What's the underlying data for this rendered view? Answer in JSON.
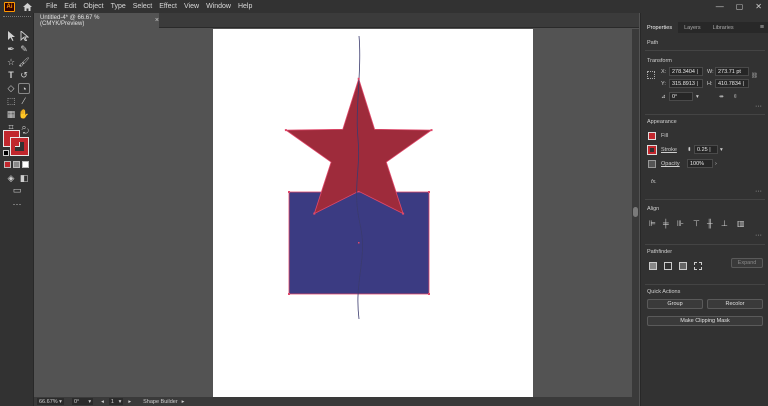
{
  "app": {
    "icon_text": "Ai",
    "menu": [
      "File",
      "Edit",
      "Object",
      "Type",
      "Select",
      "Effect",
      "View",
      "Window",
      "Help"
    ]
  },
  "document": {
    "tab_title": "Untitled-4* @ 66.67 % (CMYK/Preview)",
    "tab_close": "×"
  },
  "status": {
    "zoom": "66.67%",
    "rotation": "0°",
    "artboard": "1",
    "tool": "Shape Builder"
  },
  "panel": {
    "tabs": [
      "Properties",
      "Layers",
      "Libraries"
    ],
    "selection_type": "Path",
    "transform": {
      "title": "Transform",
      "x_label": "X:",
      "x_value": "278.3404 |",
      "y_label": "Y:",
      "y_value": "315.8913 |",
      "w_label": "W:",
      "w_value": "273.71 pt",
      "h_label": "H:",
      "h_value": "410.7834 |",
      "angle_value": "0°"
    },
    "appearance": {
      "title": "Appearance",
      "fill_label": "Fill",
      "stroke_label": "Stroke",
      "stroke_value": "0.25 |",
      "opacity_label": "Opacity",
      "opacity_value": "100%",
      "fx_label": "fx."
    },
    "align": {
      "title": "Align"
    },
    "pathfinder": {
      "title": "Pathfinder",
      "expand_label": "Expand"
    },
    "quick_actions": {
      "title": "Quick Actions",
      "group_label": "Group",
      "recolor_label": "Recolor",
      "clip_label": "Make Clipping Mask"
    }
  },
  "colors": {
    "fill": "#c1272d",
    "star": "#9e2b3b",
    "rect": "#3b3b82",
    "anchor": "#e0486a"
  }
}
